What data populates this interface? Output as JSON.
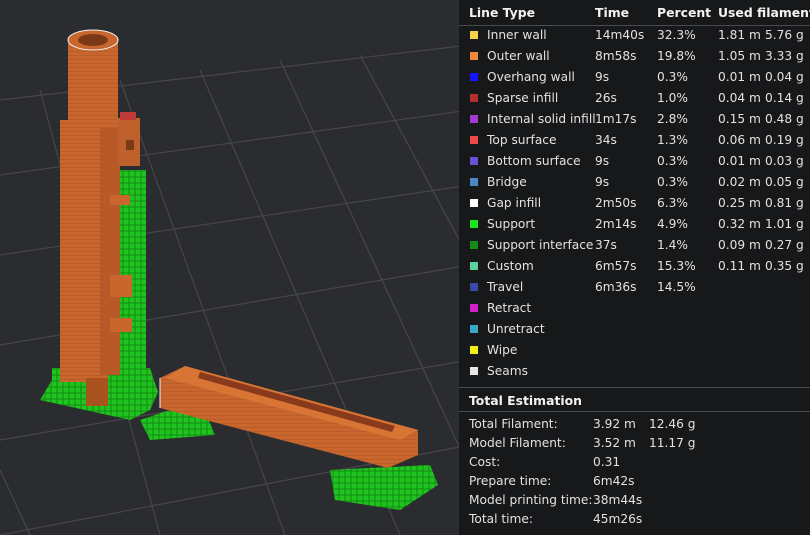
{
  "table": {
    "headers": {
      "line_type": "Line Type",
      "time": "Time",
      "percent": "Percent",
      "used_filament": "Used filament"
    },
    "rows": [
      {
        "label": "Inner wall",
        "color": "#f2d34a",
        "time": "14m40s",
        "percent": "32.3%",
        "length": "1.81 m",
        "weight": "5.76 g"
      },
      {
        "label": "Outer wall",
        "color": "#f08a3a",
        "time": "8m58s",
        "percent": "19.8%",
        "length": "1.05 m",
        "weight": "3.33 g"
      },
      {
        "label": "Overhang wall",
        "color": "#1414ff",
        "time": "9s",
        "percent": "0.3%",
        "length": "0.01 m",
        "weight": "0.04 g"
      },
      {
        "label": "Sparse infill",
        "color": "#b22e2e",
        "time": "26s",
        "percent": "1.0%",
        "length": "0.04 m",
        "weight": "0.14 g"
      },
      {
        "label": "Internal solid infill",
        "color": "#a03ad0",
        "time": "1m17s",
        "percent": "2.8%",
        "length": "0.15 m",
        "weight": "0.48 g"
      },
      {
        "label": "Top surface",
        "color": "#ef4a4a",
        "time": "34s",
        "percent": "1.3%",
        "length": "0.06 m",
        "weight": "0.19 g"
      },
      {
        "label": "Bottom surface",
        "color": "#6a4fd0",
        "time": "9s",
        "percent": "0.3%",
        "length": "0.01 m",
        "weight": "0.03 g"
      },
      {
        "label": "Bridge",
        "color": "#4a86c8",
        "time": "9s",
        "percent": "0.3%",
        "length": "0.02 m",
        "weight": "0.05 g"
      },
      {
        "label": "Gap infill",
        "color": "#ffffff",
        "time": "2m50s",
        "percent": "6.3%",
        "length": "0.25 m",
        "weight": "0.81 g"
      },
      {
        "label": "Support",
        "color": "#1ee01e",
        "time": "2m14s",
        "percent": "4.9%",
        "length": "0.32 m",
        "weight": "1.01 g"
      },
      {
        "label": "Support interface",
        "color": "#168a16",
        "time": "37s",
        "percent": "1.4%",
        "length": "0.09 m",
        "weight": "0.27 g"
      },
      {
        "label": "Custom",
        "color": "#5ed0a0",
        "time": "6m57s",
        "percent": "15.3%",
        "length": "0.11 m",
        "weight": "0.35 g"
      },
      {
        "label": "Travel",
        "color": "#3a4aa8",
        "time": "6m36s",
        "percent": "14.5%",
        "length": "",
        "weight": ""
      },
      {
        "label": "Retract",
        "color": "#d020c8",
        "time": "",
        "percent": "",
        "length": "",
        "weight": ""
      },
      {
        "label": "Unretract",
        "color": "#3aa8c8",
        "time": "",
        "percent": "",
        "length": "",
        "weight": ""
      },
      {
        "label": "Wipe",
        "color": "#f0f014",
        "time": "",
        "percent": "",
        "length": "",
        "weight": ""
      },
      {
        "label": "Seams",
        "color": "#e6e6e6",
        "time": "",
        "percent": "",
        "length": "",
        "weight": ""
      }
    ]
  },
  "totals": {
    "title": "Total Estimation",
    "rows": [
      {
        "label": "Total Filament:",
        "value": "3.92 m",
        "value2": "12.46 g"
      },
      {
        "label": "Model Filament:",
        "value": "3.52 m",
        "value2": "11.17 g"
      },
      {
        "label": "Cost:",
        "value": "0.31",
        "value2": ""
      },
      {
        "label": "Prepare time:",
        "value": "6m42s",
        "value2": ""
      },
      {
        "label": "Model printing time:",
        "value": "38m44s",
        "value2": ""
      },
      {
        "label": "Total time:",
        "value": "45m26s",
        "value2": ""
      }
    ]
  },
  "colors": {
    "model": "#c8662e",
    "support": "#1fc41f",
    "background": "#2b2c2f",
    "panel": "#161719"
  }
}
